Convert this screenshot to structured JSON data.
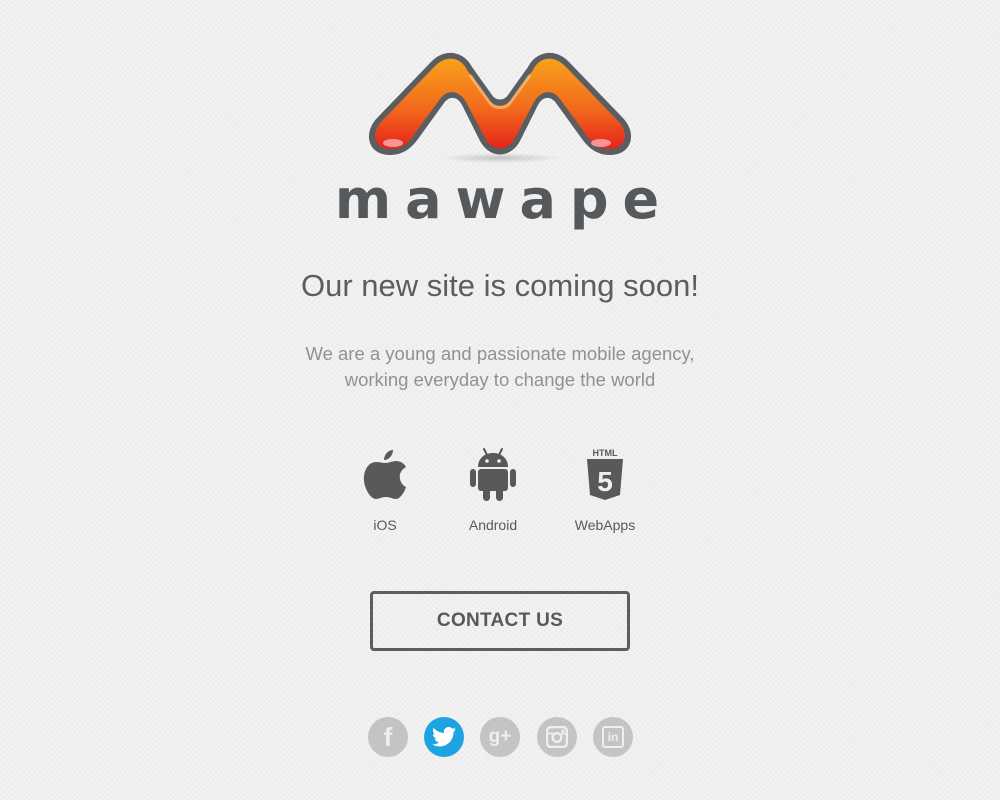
{
  "brand": {
    "wordmark": "mawape",
    "logo_colors": {
      "top": "#f59a1a",
      "bottom": "#e8281c",
      "outline": "#5a5d60"
    }
  },
  "hero": {
    "headline": "Our new site is coming soon!",
    "tagline_line1": "We are a young and passionate mobile agency,",
    "tagline_line2": "working everyday to change the world"
  },
  "platforms": [
    {
      "label": "iOS",
      "icon": "apple-icon"
    },
    {
      "label": "Android",
      "icon": "android-icon"
    },
    {
      "label": "WebApps",
      "icon": "html5-icon",
      "badge_text": "HTML",
      "badge_number": "5"
    }
  ],
  "cta": {
    "label": "CONTACT US"
  },
  "social": [
    {
      "network": "facebook",
      "icon": "facebook-icon",
      "glyph": "f",
      "active": false
    },
    {
      "network": "twitter",
      "icon": "twitter-icon",
      "active": true
    },
    {
      "network": "google-plus",
      "icon": "google-plus-icon",
      "glyph": "g+",
      "active": false
    },
    {
      "network": "instagram",
      "icon": "instagram-icon",
      "active": false
    },
    {
      "network": "linkedin",
      "icon": "linkedin-icon",
      "glyph": "in",
      "active": false
    }
  ],
  "colors": {
    "background": "#efefef",
    "text_dark": "#55595d",
    "text_light": "#8e9195",
    "social_inactive": "#c4c4c4",
    "social_active": "#1da3e2"
  }
}
